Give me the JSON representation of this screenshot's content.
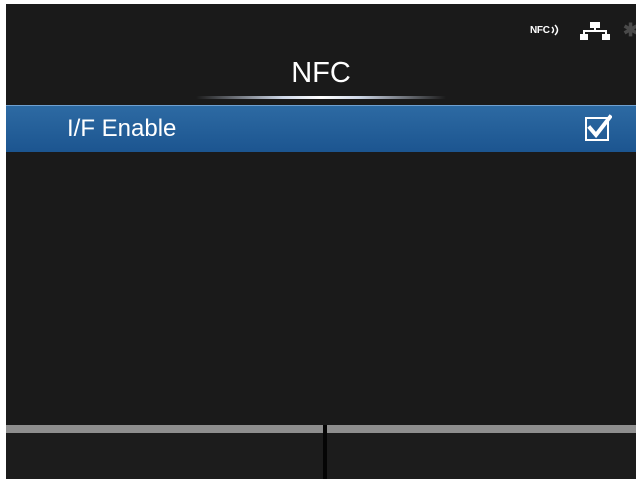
{
  "status_bar": {
    "nfc_label": "NFC",
    "icons": [
      "nfc-icon",
      "lan-icon",
      "bluetooth-icon"
    ]
  },
  "header": {
    "title": "NFC"
  },
  "menu": {
    "items": [
      {
        "label": "I/F Enable",
        "checked": true,
        "selected": true
      }
    ]
  },
  "footer": {
    "soft_keys": [
      {
        "label": ""
      },
      {
        "label": ""
      }
    ]
  },
  "colors": {
    "background": "#1a1a1a",
    "highlight": "#245f9b",
    "text": "#ffffff",
    "soft_key_border": "#8e8e8e"
  }
}
